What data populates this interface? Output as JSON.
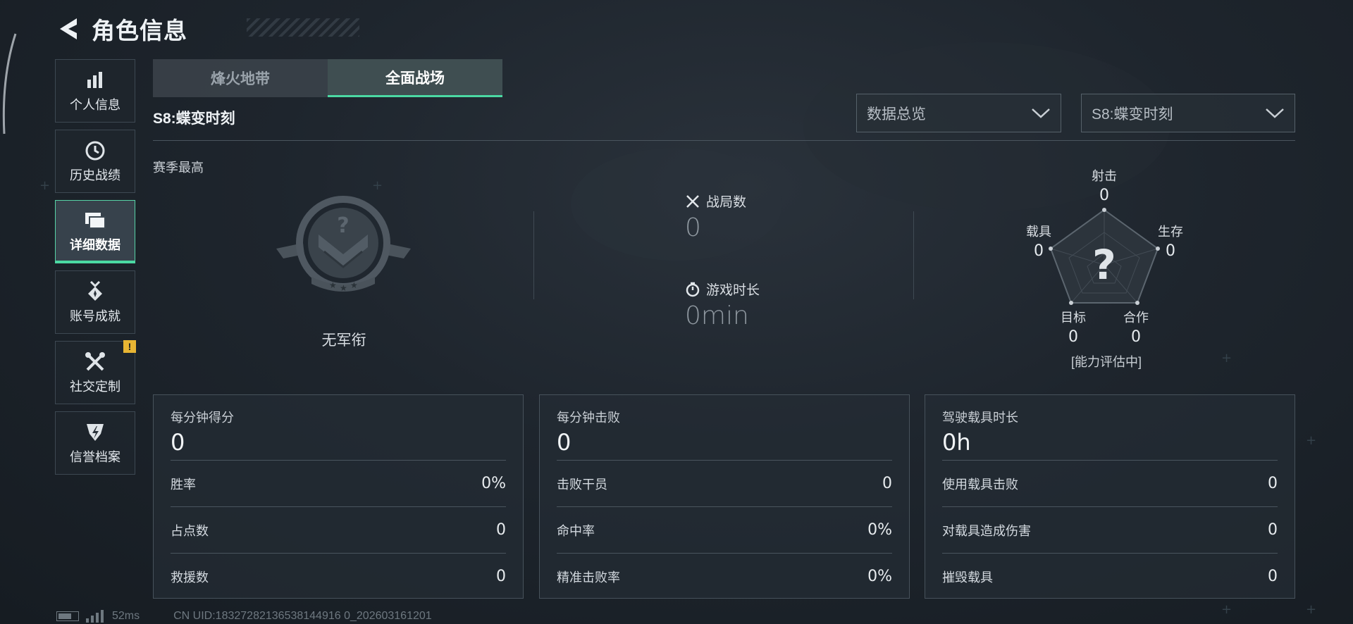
{
  "header": {
    "title": "角色信息"
  },
  "sidenav": {
    "items": [
      {
        "label": "个人信息",
        "icon": "bar-chart-icon"
      },
      {
        "label": "历史战绩",
        "icon": "history-clock-icon"
      },
      {
        "label": "详细数据",
        "icon": "folder-icon",
        "active": true
      },
      {
        "label": "账号成就",
        "icon": "medal-icon"
      },
      {
        "label": "社交定制",
        "icon": "tools-icon",
        "badge": "!"
      },
      {
        "label": "信誉档案",
        "icon": "shield-badge-icon"
      }
    ]
  },
  "tabs": [
    {
      "label": "烽火地带",
      "active": false
    },
    {
      "label": "全面战场",
      "active": true
    }
  ],
  "season_title": "S8:蝶变时刻",
  "filters": {
    "view": "数据总览",
    "season": "S8:蝶变时刻"
  },
  "season_best": {
    "label": "赛季最高",
    "rank_name": "无军衔",
    "matches_label": "战局数",
    "matches_value": "0",
    "playtime_label": "游戏时长",
    "playtime_value": "0min"
  },
  "radar": {
    "center_symbol": "?",
    "status": "[能力评估中]",
    "axes": [
      {
        "label": "射击",
        "value": "0"
      },
      {
        "label": "生存",
        "value": "0"
      },
      {
        "label": "合作",
        "value": "0"
      },
      {
        "label": "目标",
        "value": "0"
      },
      {
        "label": "载具",
        "value": "0"
      }
    ]
  },
  "panels": [
    {
      "head": "每分钟得分",
      "value": "0",
      "rows": [
        {
          "label": "胜率",
          "value": "0%"
        },
        {
          "label": "占点数",
          "value": "0"
        },
        {
          "label": "救援数",
          "value": "0"
        }
      ]
    },
    {
      "head": "每分钟击败",
      "value": "0",
      "rows": [
        {
          "label": "击败干员",
          "value": "0"
        },
        {
          "label": "命中率",
          "value": "0%"
        },
        {
          "label": "精准击败率",
          "value": "0%"
        }
      ]
    },
    {
      "head": "驾驶载具时长",
      "value": "0h",
      "rows": [
        {
          "label": "使用载具击败",
          "value": "0"
        },
        {
          "label": "对载具造成伤害",
          "value": "0"
        },
        {
          "label": "摧毁载具",
          "value": "0"
        }
      ]
    }
  ],
  "footer": {
    "ping": "52ms",
    "uid": "CN UID:18327282136538144916 0_202603161201"
  },
  "colors": {
    "accent": "#4bd9a3",
    "badge": "#e8b533",
    "background": "#1e252d"
  }
}
